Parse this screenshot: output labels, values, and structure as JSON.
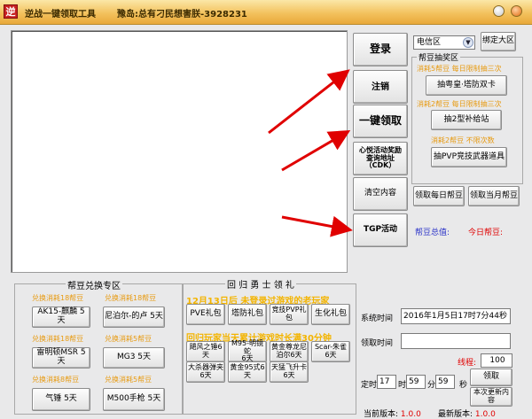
{
  "window": {
    "app_icon": "逆",
    "title": "逆战一键领取工具",
    "user": "豫岛:总有刁民想害朕-3928231"
  },
  "main_buttons": {
    "login": "登录",
    "logout": "注销",
    "claim_all": "一键领取",
    "cdk": "心悦活动奖励\n查询地址\n（CDK）",
    "clear": "清空内容",
    "tgp": "TGP活动"
  },
  "server_select": {
    "value": "电信区"
  },
  "bind_server": "绑定大区",
  "draw_area": {
    "title": "帮豆抽奖区",
    "item1_cost": "消耗5帮豆 每日限制抽三次",
    "item1_button": "抽粤皇·塔防双卡",
    "item2_cost": "消耗2帮豆 每日限制抽三次",
    "item2_button": "抽2型补给站",
    "item3_cost": "消耗2帮豆  不限次数",
    "item3_button": "抽PVP竞技武器道具",
    "daily_button": "领取每日帮豆",
    "monthly_button": "领取当月帮豆",
    "total_label": "帮豆总值:",
    "today_label": "今日帮豆:"
  },
  "exchange": {
    "title": "帮豆兑换专区",
    "items": [
      {
        "cost": "兑换消耗18帮豆",
        "button": "AK15-麒麟 5天"
      },
      {
        "cost": "兑换消耗18帮豆",
        "button": "尼泊尔-的卢 5天"
      },
      {
        "cost": "兑换消耗18帮豆",
        "button": "雷明顿MSR 5天"
      },
      {
        "cost": "兑换消耗5帮豆",
        "button": "MG3  5天"
      },
      {
        "cost": "兑换消耗8帮豆",
        "button": "气锤 5天"
      },
      {
        "cost": "兑换消耗5帮豆",
        "button": "M500手枪 5天"
      }
    ]
  },
  "veterans": {
    "title": "回 归 勇 士 领 礼",
    "line1": "12月13日后 未登录过游戏的老玩家",
    "gifts1": [
      "PVE礼包",
      "塔防礼包",
      "竞技PVP礼\n包",
      "生化礼包"
    ],
    "line2": "回归玩家当天累计游戏时长满30分钟",
    "gifts2": [
      "飓风之锤6\n天",
      "M95-明镜蛇\n6天",
      "黄金尊龙尼\n泊尔6天",
      "Scar-朱雀\n6天",
      "大杀器弹夹\n6天",
      "黄金95式6\n天",
      "天猛飞升卡\n6天"
    ]
  },
  "system": {
    "time_label": "系统时间",
    "time_value": "2016年1月5日17时7分44秒",
    "claim_time_label": "领取时间",
    "claim_time_value": "",
    "threads_label": "线程:",
    "threads_value": "100",
    "timer_label": "定时",
    "hour_value": "17",
    "hour_unit": "时",
    "minute_value": "59",
    "minute_unit": "分",
    "second_value": "59",
    "second_unit": "秒",
    "claim_button": "领取",
    "update_button": "本次更新内\n容",
    "current_version_label": "当前版本:",
    "current_version_value": "1.0.0",
    "latest_version_label": "最新版本:",
    "latest_version_value": "1.0.0"
  }
}
